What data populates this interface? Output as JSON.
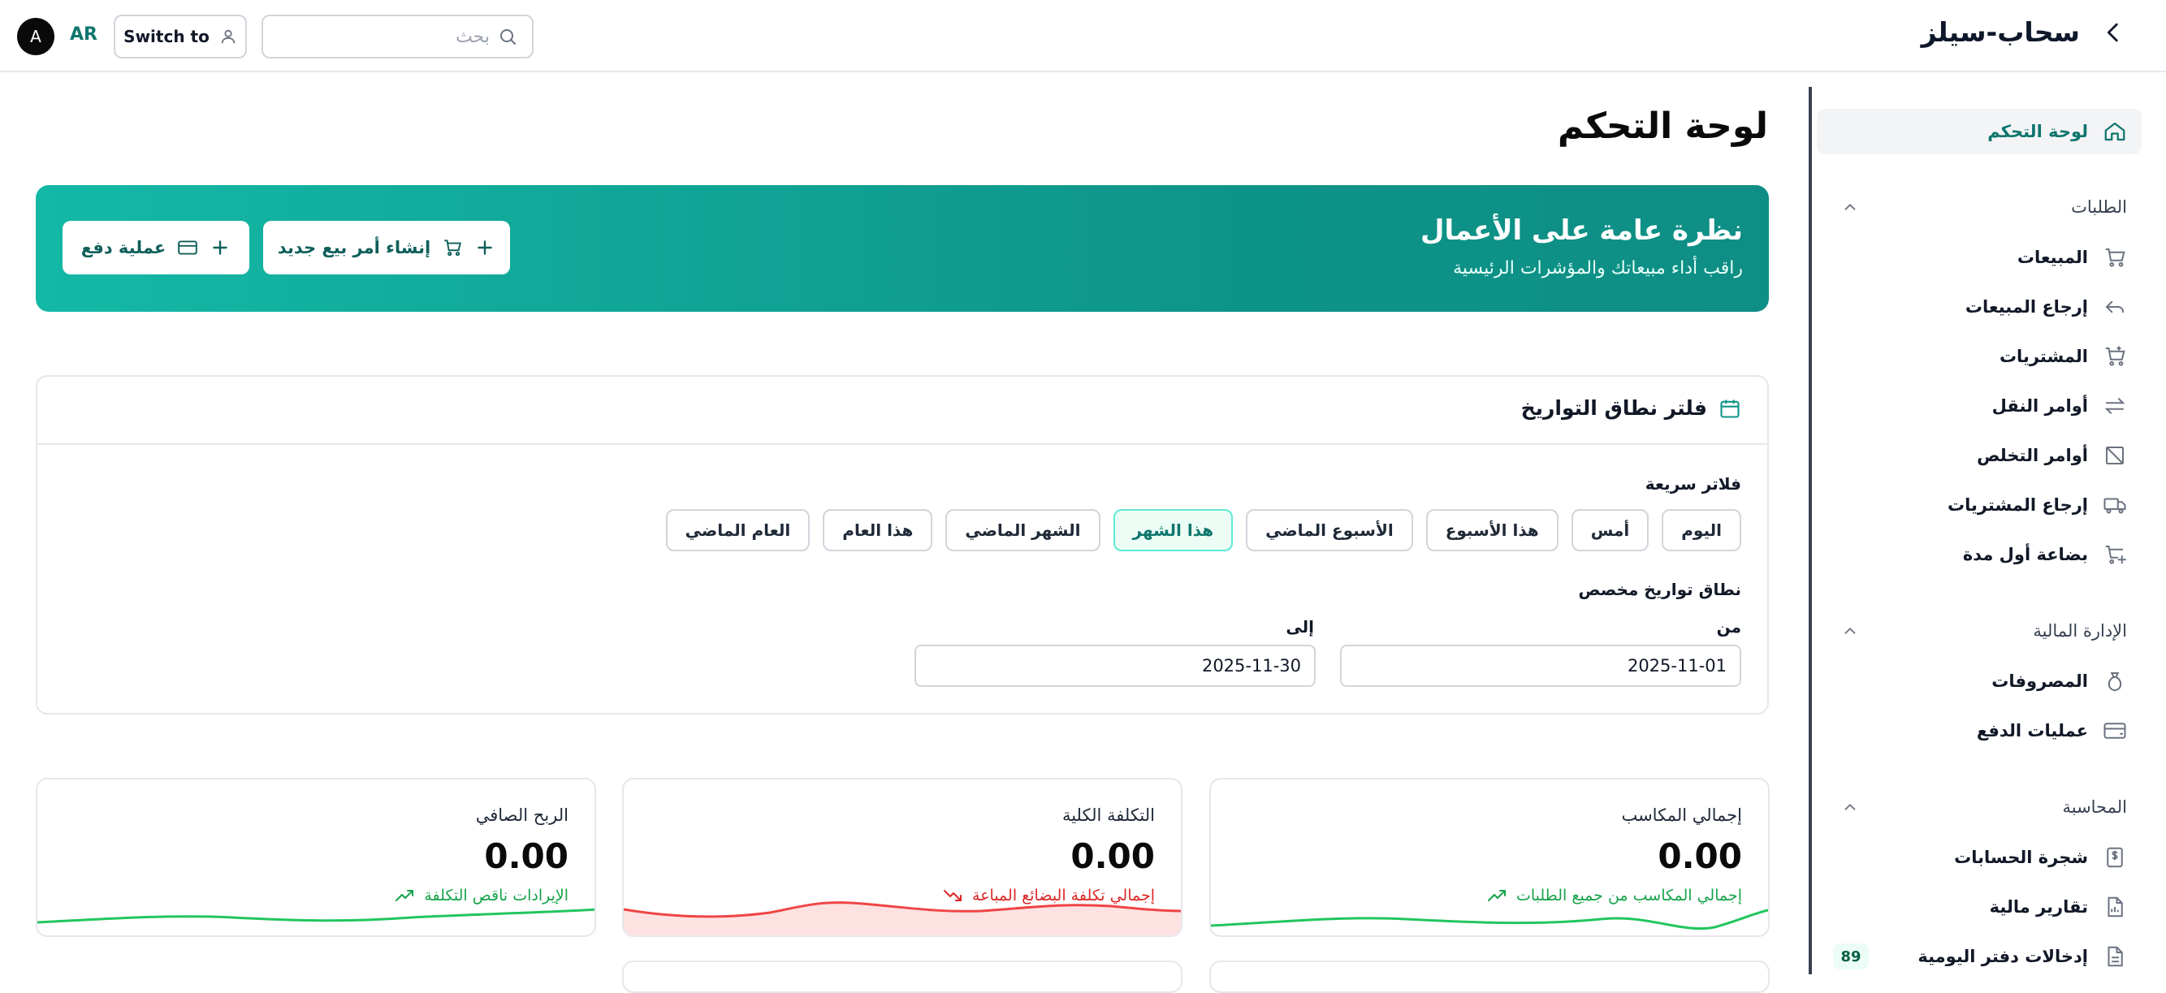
{
  "header": {
    "brand_title": "سحاب-سيلز",
    "search_placeholder": "بحث",
    "switch_label": "Switch to",
    "language": "AR",
    "avatar_initial": "A"
  },
  "sidebar": {
    "dashboard": "لوحة التحكم",
    "sections": {
      "orders": "الطلبات",
      "finance": "الإدارة المالية",
      "accounting": "المحاسبة"
    },
    "items": {
      "sales": "المبيعات",
      "sales_returns": "إرجاع المبيعات",
      "purchases": "المشتريات",
      "transfer_orders": "أوامر النقل",
      "disposal_orders": "أوامر التخلص",
      "purchase_returns": "إرجاع المشتريات",
      "opening_stock": "بضاعة أول مدة",
      "expenses": "المصروفات",
      "payments": "عمليات الدفع",
      "chart_of_accounts": "شجرة الحسابات",
      "financial_reports": "تقارير مالية",
      "journal_entries": "إدخالات دفتر اليومية"
    },
    "journal_badge": "89"
  },
  "main": {
    "page_title": "لوحة التحكم",
    "banner": {
      "title": "نظرة عامة على الأعمال",
      "subtitle": "راقب أداء مبيعاتك والمؤشرات الرئيسية",
      "new_sale_button": "إنشاء أمر بيع جديد",
      "payment_button": "عملية دفع"
    },
    "filter": {
      "title": "فلتر نطاق التواريخ",
      "quick_label": "فلاتر سريعة",
      "chips": {
        "today": "اليوم",
        "yesterday": "أمس",
        "this_week": "هذا الأسبوع",
        "last_week": "الأسبوع الماضي",
        "this_month": "هذا الشهر",
        "last_month": "الشهر الماضي",
        "this_year": "هذا العام",
        "last_year": "العام الماضي"
      },
      "active_chip": "هذا الشهر",
      "custom_label": "نطاق تواريخ مخصص",
      "from_label": "من",
      "to_label": "إلى",
      "from_value": "2025-11-01",
      "to_value": "2025-11-30"
    },
    "stats": {
      "total_earnings": {
        "label": "إجمالي المكاسب",
        "value": "0.00",
        "note": "إجمالي المكاسب من جميع الطلبات"
      },
      "total_cost": {
        "label": "التكلفة الكلية",
        "value": "0.00",
        "note": "إجمالي تكلفة البضائع المباعة"
      },
      "net_profit": {
        "label": "الربح الصافي",
        "value": "0.00",
        "note": "الإيرادات ناقص التكلفة"
      }
    },
    "colors": {
      "accent": "#0d9488",
      "positive": "#16a34a",
      "negative": "#dc2626"
    }
  }
}
